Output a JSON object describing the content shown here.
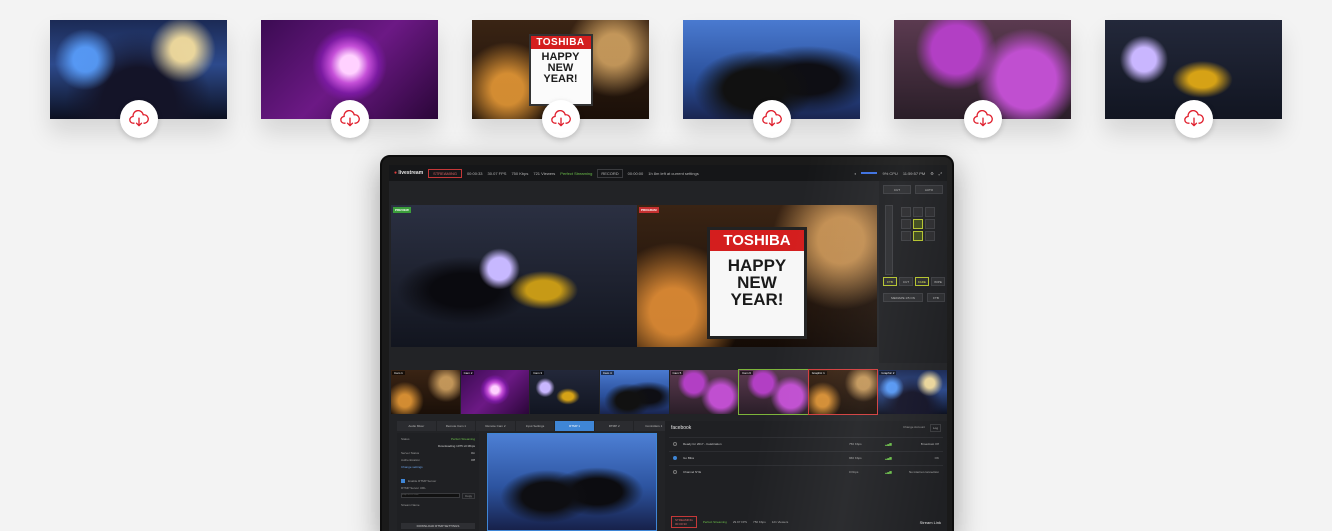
{
  "thumbnails": [
    {
      "name": "times-square",
      "style": "art-ts"
    },
    {
      "name": "ball-drop",
      "style": "art-ball"
    },
    {
      "name": "happy-new-year-sign",
      "style": "art-hny",
      "sign": {
        "brand": "TOSHIBA",
        "message": "HAPPY\nNEW\nYEAR!"
      }
    },
    {
      "name": "dancers",
      "style": "art-dance"
    },
    {
      "name": "kiss",
      "style": "art-kiss"
    },
    {
      "name": "stage",
      "style": "art-stage"
    }
  ],
  "download_icon": "cloud-download-icon",
  "accent_color": "#e0202e",
  "app": {
    "topbar": {
      "logo": "livestream",
      "stream_button": "STREAMING",
      "time": "00:00:33",
      "fps": "30.07 FPS",
      "bitrate": "750 Kbps",
      "viewers": "721 Viewers",
      "status": "Perfect Streaming",
      "record_button": "RECORD",
      "record_time": "00:00:00",
      "disk": "1h 8m left at current settings",
      "cpu": "9% CPU",
      "clock": "11:59:57 PM"
    },
    "preview_tag": "PREVIEW",
    "program_tag": "PROGRAM",
    "program_sign": {
      "brand": "TOSHIBA",
      "message": "HAPPY\nNEW\nYEAR!"
    },
    "controls": {
      "cut": "CUT",
      "auto": "AUTO",
      "buttons": [
        "FTB",
        "CUT",
        "FADE",
        "WIPE"
      ],
      "transition_label": "MEDIAPE 1/5 ON",
      "ftb": "FTB"
    },
    "sources": [
      {
        "label": "Cam 1",
        "state": ""
      },
      {
        "label": "Cam 2",
        "state": ""
      },
      {
        "label": "Cam 3",
        "state": ""
      },
      {
        "label": "Cam 4",
        "state": ""
      },
      {
        "label": "Cam 5",
        "state": ""
      },
      {
        "label": "Cam 6",
        "state": "prev"
      },
      {
        "label": "Graphic 1",
        "state": "live"
      },
      {
        "label": "Graphic 2",
        "state": ""
      }
    ],
    "tabs": [
      "Audio Mixer",
      "Remote Cam 1",
      "Remote Cam 2",
      "Input Settings",
      "RTMP 1",
      "RTMP 2",
      "Controllers 1"
    ],
    "active_tab": 4,
    "settings": {
      "status_label": "Status",
      "status_value": "Perfect Streaming",
      "format_value": "Downloading 1075 x0 Mbps",
      "server_label": "Server Status",
      "server_value": "On",
      "auth_label": "Authentication",
      "auth_value": "Off",
      "change_label": "Change settings",
      "enable_label": "Enable RTMP Server",
      "url_label": "RTMP Server URL",
      "url_placeholder": "rtmp://10.0.0.1/live",
      "copy_button": "Copy",
      "stream_name_label": "Stream Name",
      "footer_button": "DOWNLOAD RTMP SETTINGS"
    },
    "facebook": {
      "title": "facebook",
      "change_account": "Change Account",
      "log_button": "Log",
      "rows": [
        {
          "name": "Ready for 2017 - Celebration",
          "rate": "750 Kbps",
          "status": "Broadcast Off",
          "selected": false
        },
        {
          "name": "Go Bliss",
          "rate": "960 Kbps",
          "status": "OK",
          "selected": true
        },
        {
          "name": "Channel NYE",
          "rate": "0 Kbps",
          "status": "No internet connection",
          "selected": false
        }
      ],
      "stop_button": "STREAMING",
      "stop_time": "00:00:33",
      "status": "Perfect Streaming",
      "fps": "29.97 FPS",
      "bitrate": "750 Kbps",
      "viewers": "121 Viewers",
      "stream_link": "Stream Link"
    }
  }
}
